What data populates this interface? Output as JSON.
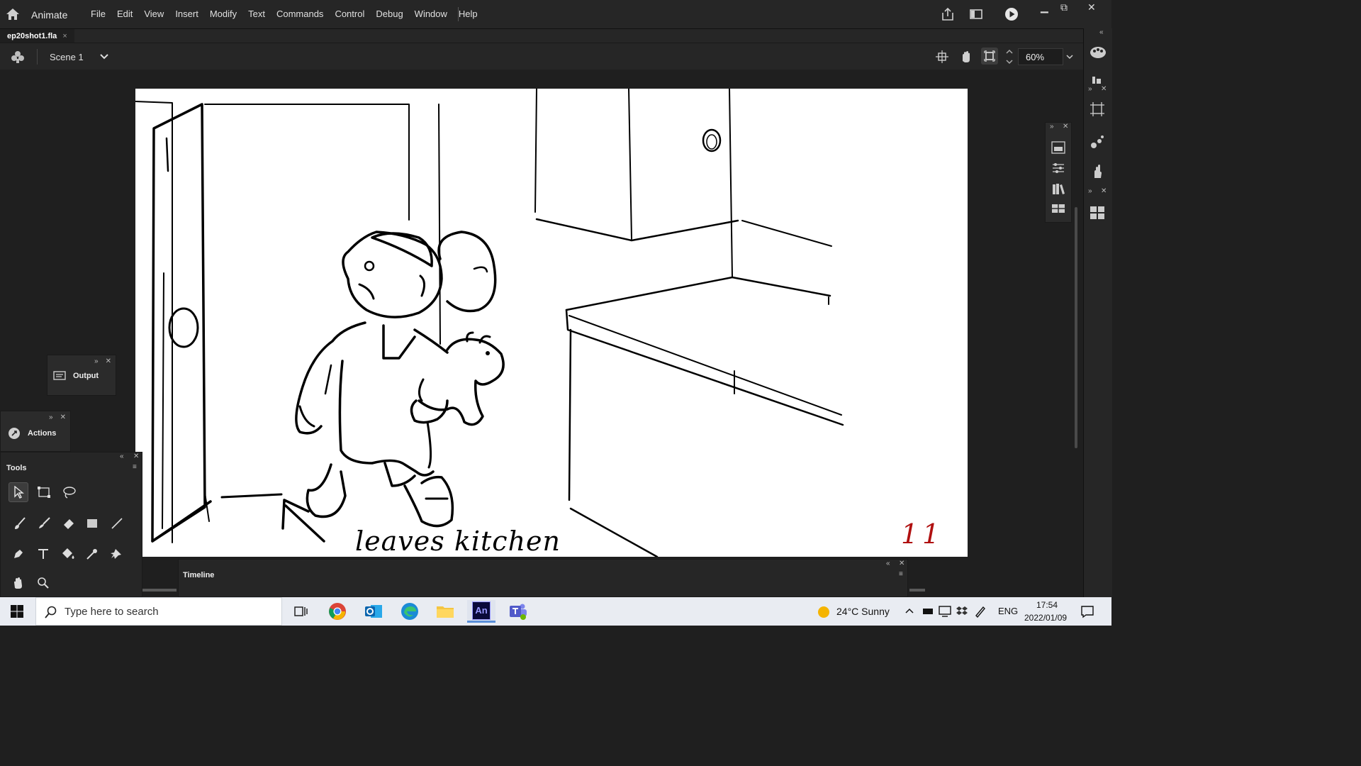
{
  "app": {
    "name": "Animate",
    "menus": [
      "File",
      "Edit",
      "View",
      "Insert",
      "Modify",
      "Text",
      "Commands",
      "Control",
      "Debug",
      "Window",
      "Help"
    ]
  },
  "document": {
    "tab_name": "ep20shot1.fla",
    "close_glyph": "×"
  },
  "scene": {
    "label": "Scene 1",
    "zoom": "60%"
  },
  "canvas": {
    "caption": "leaves kitchen",
    "panel_number": "11",
    "number_color": "#b01010"
  },
  "panels": {
    "output_label": "Output",
    "actions_label": "Actions",
    "tools_title": "Tools",
    "timeline_title": "Timeline"
  },
  "tools": [
    "selection-tool",
    "free-transform-tool",
    "lasso-tool",
    "paint-brush-tool",
    "brush-tool",
    "eraser-tool",
    "rectangle-tool",
    "line-tool",
    "pen-tool",
    "text-tool",
    "paint-bucket-tool",
    "eyedropper-tool",
    "pin-tool",
    "hand-tool",
    "zoom-tool"
  ],
  "taskbar": {
    "search_placeholder": "Type here to search",
    "weather": "24°C  Sunny",
    "language": "ENG",
    "time": "17:54",
    "date": "2022/01/09",
    "animate_badge": "An"
  },
  "colors": {
    "accent": "#5a8fd8",
    "ui_bg": "#262626",
    "stage_bg": "#1f1f1f"
  }
}
